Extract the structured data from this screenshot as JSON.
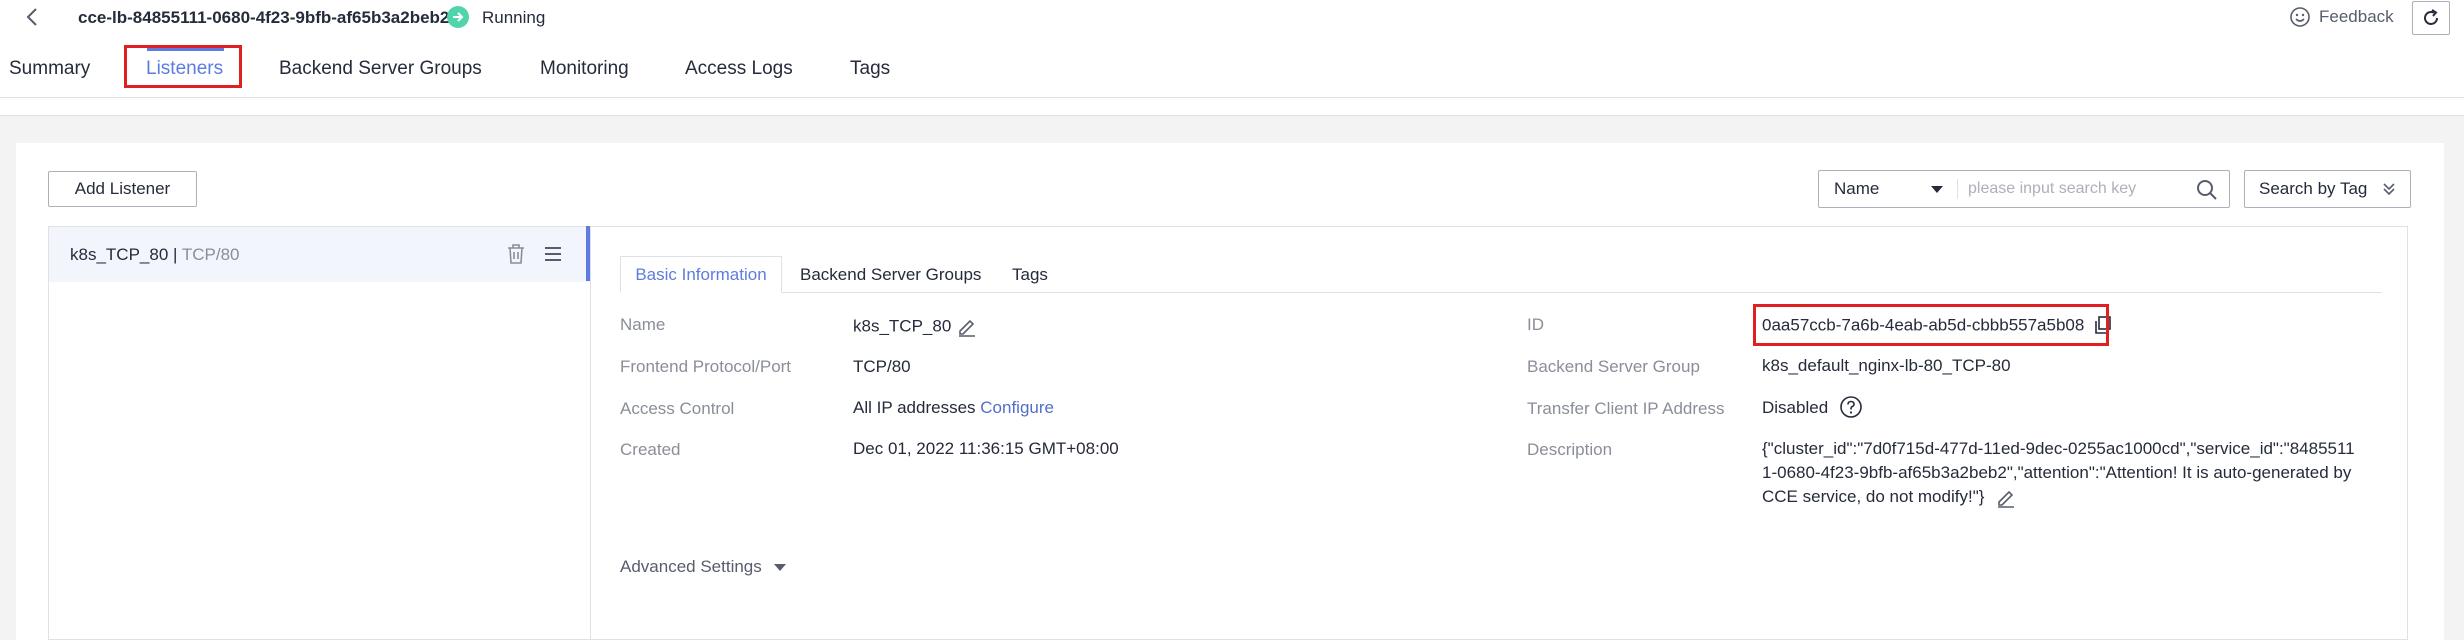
{
  "header": {
    "title": "cce-lb-84855111-0680-4f23-9bfb-af65b3a2beb2",
    "status": "Running",
    "feedback_label": "Feedback"
  },
  "tabs": [
    {
      "label": "Summary"
    },
    {
      "label": "Listeners",
      "active": true
    },
    {
      "label": "Backend Server Groups"
    },
    {
      "label": "Monitoring"
    },
    {
      "label": "Access Logs"
    },
    {
      "label": "Tags"
    }
  ],
  "toolbar": {
    "add_listener_label": "Add Listener",
    "search_field_selected": "Name",
    "search_placeholder": "please input search key",
    "search_by_tag_label": "Search by Tag"
  },
  "listeners": [
    {
      "name": "k8s_TCP_80",
      "separator": "|",
      "port": "TCP/80"
    }
  ],
  "detail": {
    "sub_tabs": [
      {
        "label": "Basic Information",
        "active": true
      },
      {
        "label": "Backend Server Groups"
      },
      {
        "label": "Tags"
      }
    ],
    "fields": {
      "name_label": "Name",
      "name_value": "k8s_TCP_80",
      "protocol_label": "Frontend Protocol/Port",
      "protocol_value": "TCP/80",
      "access_label": "Access Control",
      "access_value": "All IP addresses",
      "access_link": "Configure",
      "created_label": "Created",
      "created_value": "Dec 01, 2022 11:36:15 GMT+08:00",
      "id_label": "ID",
      "id_value": "0aa57ccb-7a6b-4eab-ab5d-cbbb557a5b08",
      "backend_label": "Backend Server Group",
      "backend_value": "k8s_default_nginx-lb-80_TCP-80",
      "transfer_label": "Transfer Client IP Address",
      "transfer_value": "Disabled",
      "description_label": "Description",
      "description_value": "{\"cluster_id\":\"7d0f715d-477d-11ed-9dec-0255ac1000cd\",\"service_id\":\"84855111-0680-4f23-9bfb-af65b3a2beb2\",\"attention\":\"Attention! It is auto-generated by CCE service, do not modify!\"}"
    },
    "advanced_settings_label": "Advanced Settings"
  },
  "colors": {
    "accent": "#5e7ce0",
    "status_running": "#50d4ab",
    "highlight": "#e02020"
  }
}
